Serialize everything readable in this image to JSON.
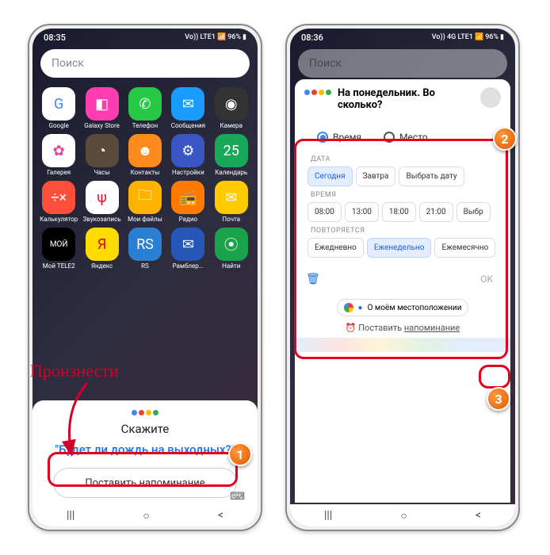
{
  "left": {
    "status": {
      "time": "08:35",
      "battery": "96%",
      "net": "Vo)) LTE1"
    },
    "search_placeholder": "Поиск",
    "apps_rows": [
      [
        {
          "label": "Google",
          "bg": "#fff",
          "glyph": "G",
          "fg": "#4285f4"
        },
        {
          "label": "Galaxy Store",
          "bg": "#ff3db0",
          "glyph": "◧"
        },
        {
          "label": "Телефон",
          "bg": "#27c845",
          "glyph": "✆"
        },
        {
          "label": "Сообщения",
          "bg": "#1a9cff",
          "glyph": "✉"
        },
        {
          "label": "Камера",
          "bg": "#333",
          "glyph": "◉"
        }
      ],
      [
        {
          "label": "Галерея",
          "bg": "#fff",
          "glyph": "✿",
          "fg": "#e84393"
        },
        {
          "label": "Часы",
          "bg": "#5a4a3a",
          "glyph": "◔"
        },
        {
          "label": "Контакты",
          "bg": "#ff8a1e",
          "glyph": "☻"
        },
        {
          "label": "Настройки",
          "bg": "#3a56c4",
          "glyph": "⚙"
        },
        {
          "label": "Календарь",
          "bg": "#18a85a",
          "glyph": "25"
        }
      ],
      [
        {
          "label": "Калькулятор",
          "bg": "#ff4f3a",
          "glyph": "÷×"
        },
        {
          "label": "Звукозапись",
          "bg": "#fff",
          "glyph": "ψ",
          "fg": "#e6122d"
        },
        {
          "label": "Мои файлы",
          "bg": "#ffb300",
          "glyph": "🗀"
        },
        {
          "label": "Радио",
          "bg": "#ff7a00",
          "glyph": "📻"
        },
        {
          "label": "Почта",
          "bg": "#ffca00",
          "glyph": "✉"
        }
      ],
      [
        {
          "label": "Мой TELE2",
          "bg": "#000",
          "glyph": "МОЙ"
        },
        {
          "label": "Яндекс",
          "bg": "#ffdb00",
          "glyph": "Я",
          "fg": "#e6001b"
        },
        {
          "label": "RS",
          "bg": "#2a7fd4",
          "glyph": "RS"
        },
        {
          "label": "Рамблер...",
          "bg": "#2556b8",
          "glyph": "✉"
        },
        {
          "label": "Найти",
          "bg": "#1aa34a",
          "glyph": "⦿"
        }
      ]
    ],
    "assistant": {
      "say": "Скажите",
      "example": "\"Будет ли дождь на выходных?\"",
      "reminder_btn": "Поставить напоминание"
    }
  },
  "right": {
    "status": {
      "time": "08:36",
      "battery": "96%",
      "net": "Vo)) 4G LTE1"
    },
    "search_placeholder": "Поиск",
    "card_title": "На понедельник. Во сколько?",
    "radios": {
      "time": "Время",
      "place": "Место"
    },
    "date_label": "ДАТА",
    "date_chips": [
      {
        "label": "Сегодня",
        "sel": true
      },
      {
        "label": "Завтра",
        "sel": false
      },
      {
        "label": "Выбрать дату",
        "sel": false
      }
    ],
    "time_label": "ВРЕМЯ",
    "time_chips": [
      {
        "label": "08:00"
      },
      {
        "label": "13:00"
      },
      {
        "label": "18:00"
      },
      {
        "label": "21:00"
      },
      {
        "label": "Выбр"
      }
    ],
    "repeat_label": "ПОВТОРЯЕТСЯ",
    "repeat_chips": [
      {
        "label": "Ежедневно",
        "sel": false
      },
      {
        "label": "Еженедельно",
        "sel": true
      },
      {
        "label": "Ежемесячно",
        "sel": false
      }
    ],
    "ok": "OK",
    "suggestion": "О моём местоположении",
    "reminder_prefix": "Поставить ",
    "reminder_link": "напоминание"
  },
  "annotation": {
    "speak": "Произнести"
  },
  "nav": {
    "recent": "|||",
    "home": "○",
    "back": "<"
  }
}
